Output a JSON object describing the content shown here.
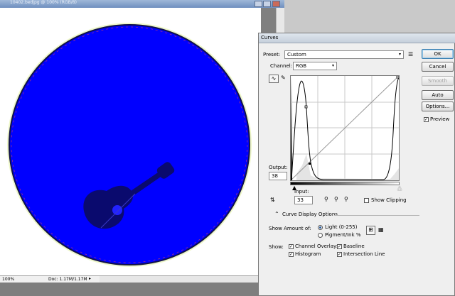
{
  "document": {
    "title": "10402.bedjpg @ 100% (RGB/8)",
    "zoom": "100%",
    "doc_size": "Doc: 1.17M/1.17M"
  },
  "curves": {
    "title": "Curves",
    "preset_label": "Preset:",
    "preset_value": "Custom",
    "channel_label": "Channel:",
    "channel_value": "RGB",
    "output_label": "Output:",
    "output_value": "38",
    "input_label": "Input:",
    "input_value": "33",
    "show_clipping": "Show Clipping",
    "curve_display_options": "Curve Display Options",
    "show_amount_label": "Show Amount of:",
    "light_option": "Light  (0-255)",
    "pigment_option": "Pigment/Ink %",
    "show_label": "Show:",
    "channel_overlays": "Channel Overlays",
    "baseline": "Baseline",
    "histogram": "Histogram",
    "intersection_line": "Intersection Line",
    "buttons": {
      "ok": "OK",
      "cancel": "Cancel",
      "smooth": "Smooth",
      "auto": "Auto",
      "options": "Options..."
    },
    "preview_label": "Preview",
    "preview_checked": true
  },
  "colors": {
    "disc": "#0000ff",
    "guitar": "#0a0a6e",
    "button_default_border": "#3c7fb1"
  }
}
